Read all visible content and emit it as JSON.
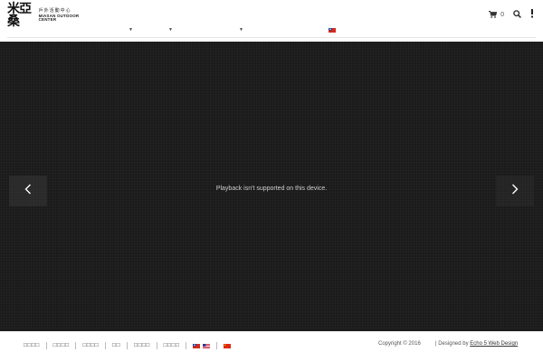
{
  "header": {
    "logo": {
      "mark": "米亞桑",
      "glyphs": "戶外活動中心",
      "subtitle": "MIASAN OUTDOOR CENTER"
    },
    "cart_count": "0",
    "nav_dropdowns": 3,
    "flag": "taiwan"
  },
  "hero": {
    "playback_message": "Playback isn't supported on this device."
  },
  "footer": {
    "links": [
      "□□□□",
      "□□□□",
      "□□□□",
      "□□",
      "□□□□",
      "□□□□"
    ],
    "language_flags": [
      "taiwan",
      "usa",
      "china"
    ],
    "copyright": "Copyright © 2016",
    "designed_by_prefix": "| Designed by ",
    "designed_by_link": "Echo 5 Web Design"
  },
  "colors": {
    "hero_bg": "#1b1b1b",
    "header_bg": "#ffffff",
    "text_dark": "#333333"
  }
}
